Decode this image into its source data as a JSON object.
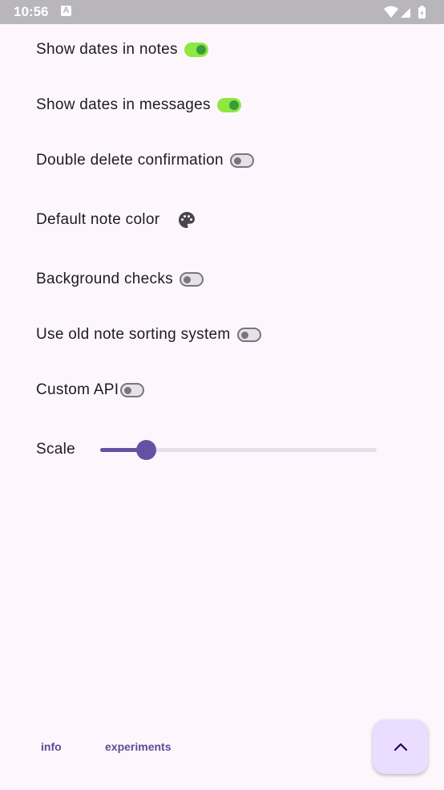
{
  "status_bar": {
    "time": "10:56",
    "notification_icon": "a-letter-icon",
    "icons": [
      "wifi-icon",
      "signal-icon",
      "battery-icon"
    ]
  },
  "settings": {
    "show_dates_in_notes": {
      "label": "Show dates in notes",
      "on": true
    },
    "show_dates_in_messages": {
      "label": "Show dates in messages",
      "on": true
    },
    "double_delete_confirmation": {
      "label": "Double delete confirmation",
      "on": false
    },
    "default_note_color": {
      "label": "Default note color",
      "icon": "palette-icon"
    },
    "background_checks": {
      "label": "Background checks",
      "on": false
    },
    "old_note_sorting": {
      "label": "Use old note sorting system",
      "on": false
    },
    "custom_api": {
      "label": "Custom API",
      "on": false
    },
    "scale": {
      "label": "Scale",
      "value_fraction": 0.16
    }
  },
  "bottom_nav": {
    "info_label": "info",
    "experiments_label": "experiments"
  },
  "fab": {
    "icon": "chevron-up-icon"
  },
  "colors": {
    "background": "#fdf7fd",
    "switch_on_track": "#8ee83f",
    "switch_on_thumb": "#3a9a3f",
    "switch_off_outline": "#79747e",
    "slider_active": "#6750a4",
    "fab_background": "#eaddff",
    "link_text": "#5d4a96"
  }
}
